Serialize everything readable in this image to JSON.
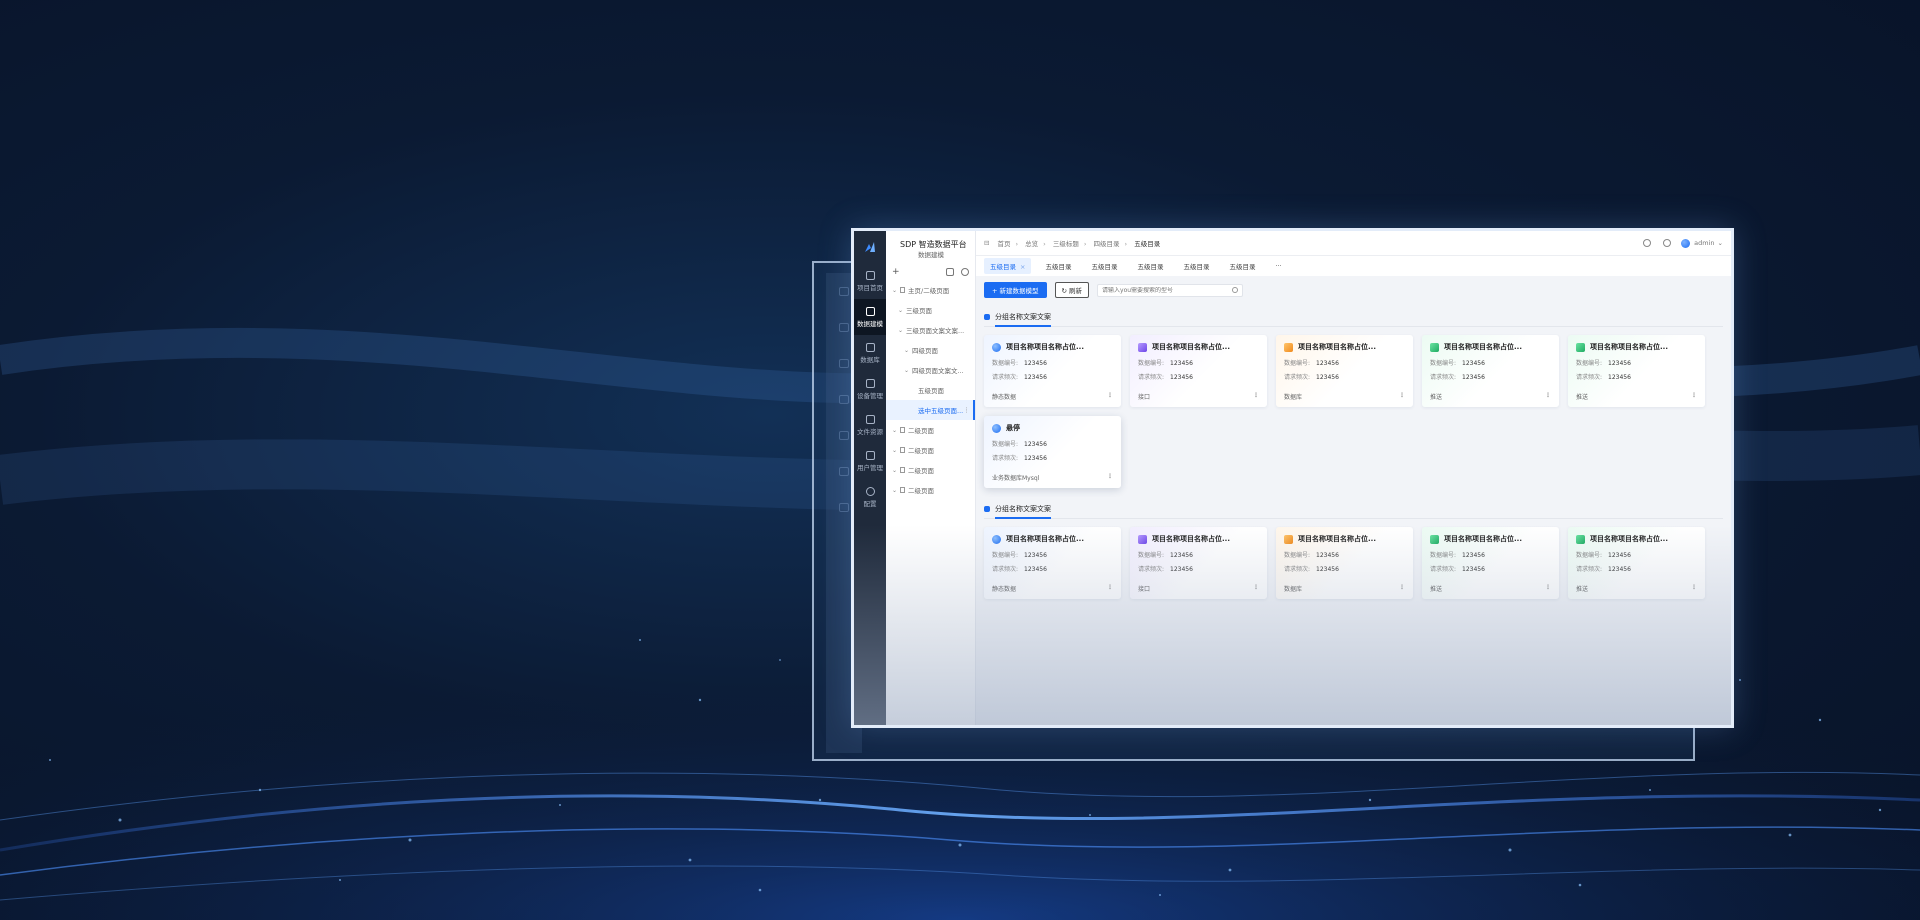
{
  "app": {
    "platform_name": "SDP 智造数据平台",
    "module_name": "数据建模",
    "accent_color": "#1b6cf2",
    "user": "admin"
  },
  "nav": [
    {
      "label": "项目首页",
      "icon": "home-icon"
    },
    {
      "label": "数据建模",
      "icon": "model-icon",
      "active": true
    },
    {
      "label": "数据库",
      "icon": "database-icon"
    },
    {
      "label": "设备管理",
      "icon": "device-icon"
    },
    {
      "label": "文件资源",
      "icon": "file-icon"
    },
    {
      "label": "用户管理",
      "icon": "user-icon"
    },
    {
      "label": "配置",
      "icon": "settings-icon"
    }
  ],
  "tree": {
    "add_symbol": "+",
    "more_symbol": "⋮",
    "items": [
      {
        "label": "主页/二级页面",
        "level": 1,
        "expand": "⌄"
      },
      {
        "label": "三级页面",
        "level": 2,
        "expand": "⌄"
      },
      {
        "label": "三级页面文案文案...",
        "level": 2,
        "expand": "⌄"
      },
      {
        "label": "四级页面",
        "level": 3,
        "expand": "⌄"
      },
      {
        "label": "四级页面文案文...",
        "level": 3,
        "expand": "⌄"
      },
      {
        "label": "五级页面",
        "level": 4,
        "expand": ""
      },
      {
        "label": "选中五级页面...",
        "level": 4,
        "expand": "",
        "selected": true
      },
      {
        "label": "二级页面",
        "level": 1,
        "expand": "⌄"
      },
      {
        "label": "二级页面",
        "level": 1,
        "expand": "⌄"
      },
      {
        "label": "二级页面",
        "level": 1,
        "expand": "⌄"
      },
      {
        "label": "二级页面",
        "level": 1,
        "expand": "⌄"
      }
    ]
  },
  "breadcrumb": [
    "首页",
    "总览",
    "三级标题",
    "四级目录",
    "五级目录"
  ],
  "tabs": [
    {
      "label": "五级目录",
      "active": true,
      "close": "×"
    },
    {
      "label": "五级目录"
    },
    {
      "label": "五级目录"
    },
    {
      "label": "五级目录"
    },
    {
      "label": "五级目录"
    },
    {
      "label": "五级目录"
    }
  ],
  "tabs_more": "···",
  "toolbar": {
    "new_label": "+ 新建数据模型",
    "refresh_label": "刷新",
    "search_placeholder": "请输入you需要搜索的型号"
  },
  "groups": [
    {
      "title": "分组名称文案文案",
      "cards": [
        {
          "title": "项目名称项目名称占位...",
          "icon": "globe-icon",
          "tone": "blue",
          "id_label": "数据编号:",
          "id_value": "123456",
          "freq_label": "请求频次:",
          "freq_value": "123456",
          "type": "静态数据"
        },
        {
          "title": "项目名称项目名称占位...",
          "icon": "api-icon",
          "tone": "purple",
          "id_label": "数据编号:",
          "id_value": "123456",
          "freq_label": "请求频次:",
          "freq_value": "123456",
          "type": "接口"
        },
        {
          "title": "项目名称项目名称占位...",
          "icon": "db-icon",
          "tone": "orange",
          "id_label": "数据编号:",
          "id_value": "123456",
          "freq_label": "请求频次:",
          "freq_value": "123456",
          "type": "数据库"
        },
        {
          "title": "项目名称项目名称占位...",
          "icon": "push-icon",
          "tone": "green",
          "id_label": "数据编号:",
          "id_value": "123456",
          "freq_label": "请求频次:",
          "freq_value": "123456",
          "type": "推送"
        },
        {
          "title": "项目名称项目名称占位...",
          "icon": "push-icon",
          "tone": "green",
          "id_label": "数据编号:",
          "id_value": "123456",
          "freq_label": "请求频次:",
          "freq_value": "123456",
          "type": "推送"
        },
        {
          "title": "悬停",
          "icon": "globe-icon",
          "tone": "blue",
          "id_label": "数据编号:",
          "id_value": "123456",
          "freq_label": "请求频次:",
          "freq_value": "123456",
          "type": "业务数据库Mysql"
        }
      ]
    },
    {
      "title": "分组名称文案文案",
      "cards": [
        {
          "title": "项目名称项目名称占位...",
          "icon": "globe-icon",
          "tone": "blue",
          "id_label": "数据编号:",
          "id_value": "123456",
          "freq_label": "请求频次:",
          "freq_value": "123456",
          "type": "静态数据"
        },
        {
          "title": "项目名称项目名称占位...",
          "icon": "api-icon",
          "tone": "purple",
          "id_label": "数据编号:",
          "id_value": "123456",
          "freq_label": "请求频次:",
          "freq_value": "123456",
          "type": "接口"
        },
        {
          "title": "项目名称项目名称占位...",
          "icon": "db-icon",
          "tone": "orange",
          "id_label": "数据编号:",
          "id_value": "123456",
          "freq_label": "请求频次:",
          "freq_value": "123456",
          "type": "数据库"
        },
        {
          "title": "项目名称项目名称占位...",
          "icon": "push-icon",
          "tone": "green",
          "id_label": "数据编号:",
          "id_value": "123456",
          "freq_label": "请求频次:",
          "freq_value": "123456",
          "type": "推送"
        },
        {
          "title": "项目名称项目名称占位...",
          "icon": "push-icon",
          "tone": "green",
          "id_label": "数据编号:",
          "id_value": "123456",
          "freq_label": "请求频次:",
          "freq_value": "123456",
          "type": "推送"
        }
      ]
    }
  ],
  "card_more": "⋮"
}
